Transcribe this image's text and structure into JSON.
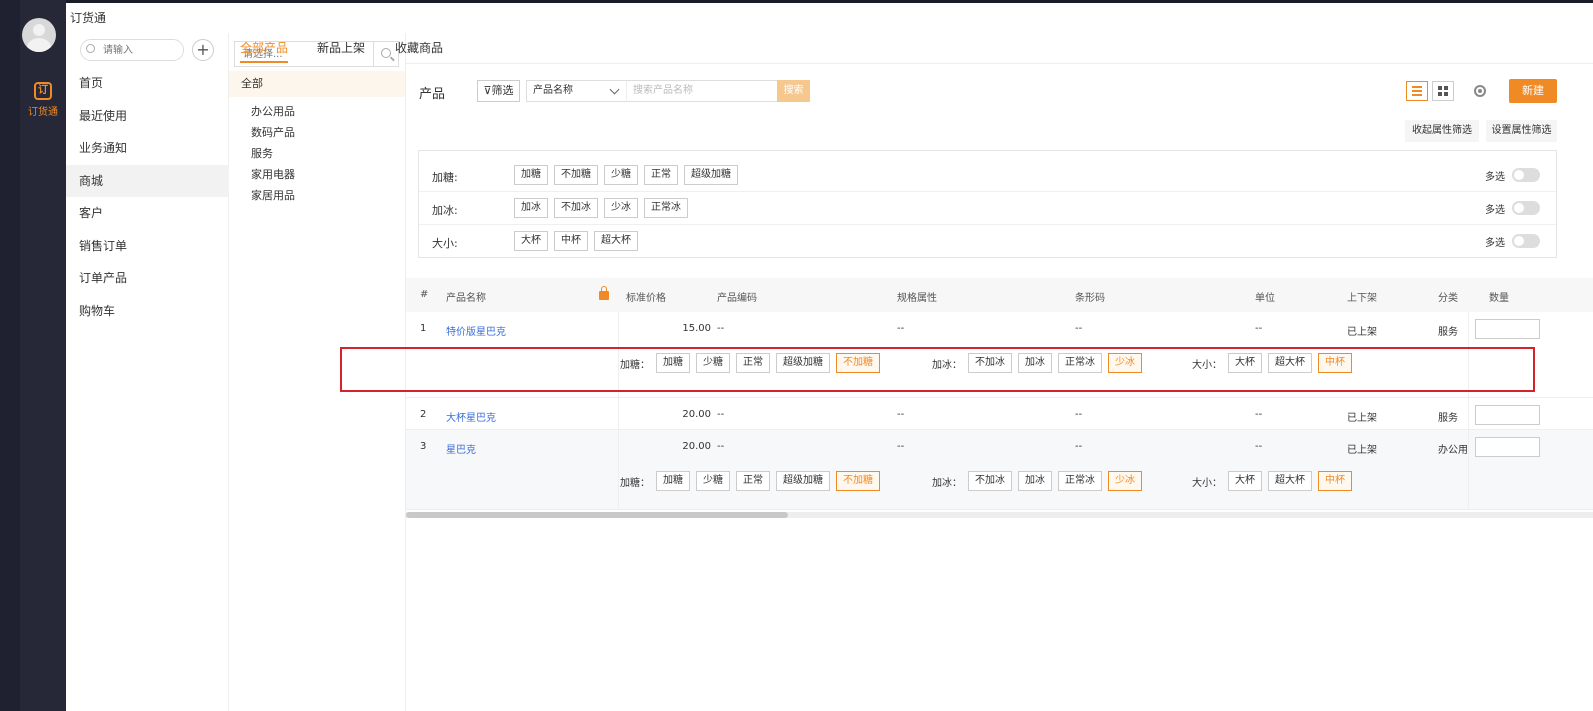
{
  "app": {
    "title": "订货通",
    "nav_label": "订货通",
    "nav_logo": "订"
  },
  "menu": {
    "search_placeholder": "请输入",
    "add_label": "+",
    "items": [
      "首页",
      "最近使用",
      "业务通知",
      "商城",
      "客户",
      "销售订单",
      "订单产品",
      "购物车"
    ],
    "active": "商城"
  },
  "categories": {
    "search_placeholder": "请选择...",
    "all": "全部",
    "items": [
      "办公用品",
      "数码产品",
      "服务",
      "家用电器",
      "家居用品"
    ]
  },
  "tabs": [
    "全部产品",
    "新品上架",
    "收藏商品"
  ],
  "toolbar": {
    "title": "产品",
    "filter_label": "筛选",
    "field_select": "产品名称",
    "search_placeholder": "搜索产品名称",
    "search_btn": "搜索",
    "new_btn": "新建",
    "collapse_btn": "收起属性筛选",
    "set_filter_btn": "设置属性筛选",
    "icons": [
      "list-view-icon",
      "grid-view-icon",
      "settings-icon"
    ]
  },
  "attr_filters": [
    {
      "label": "加糖:",
      "options": [
        "加糖",
        "不加糖",
        "少糖",
        "正常",
        "超级加糖"
      ],
      "multi": "多选"
    },
    {
      "label": "加冰:",
      "options": [
        "加冰",
        "不加冰",
        "少冰",
        "正常冰"
      ],
      "multi": "多选"
    },
    {
      "label": "大小:",
      "options": [
        "大杯",
        "中杯",
        "超大杯"
      ],
      "multi": "多选"
    }
  ],
  "table": {
    "headers": [
      "#",
      "产品名称",
      "标准价格",
      "产品编码",
      "规格属性",
      "条形码",
      "单位",
      "上下架",
      "分类",
      "数量"
    ],
    "rows": [
      {
        "num": "1",
        "name": "特价版星巴克",
        "price": "15.00",
        "code": "--",
        "spec": "--",
        "barcode": "--",
        "unit": "--",
        "status": "已上架",
        "category": "服务",
        "has_specs": true
      },
      {
        "num": "2",
        "name": "大杯星巴克",
        "price": "20.00",
        "code": "--",
        "spec": "--",
        "barcode": "--",
        "unit": "--",
        "status": "已上架",
        "category": "服务",
        "has_specs": false
      },
      {
        "num": "3",
        "name": "星巴克",
        "price": "20.00",
        "code": "--",
        "spec": "--",
        "barcode": "--",
        "unit": "--",
        "status": "已上架",
        "category": "办公用",
        "has_specs": true
      }
    ],
    "specs": [
      {
        "label": "加糖：",
        "options": [
          "加糖",
          "少糖",
          "正常",
          "超级加糖",
          "不加糖"
        ],
        "selected": "不加糖"
      },
      {
        "label": "加冰：",
        "options": [
          "不加冰",
          "加冰",
          "正常冰",
          "少冰"
        ],
        "selected": "少冰"
      },
      {
        "label": "大小：",
        "options": [
          "大杯",
          "超大杯",
          "中杯"
        ],
        "selected": "中杯"
      }
    ]
  },
  "colors": {
    "accent": "#f08a24",
    "link": "#3a6fd8",
    "highlight": "#d4232b"
  }
}
